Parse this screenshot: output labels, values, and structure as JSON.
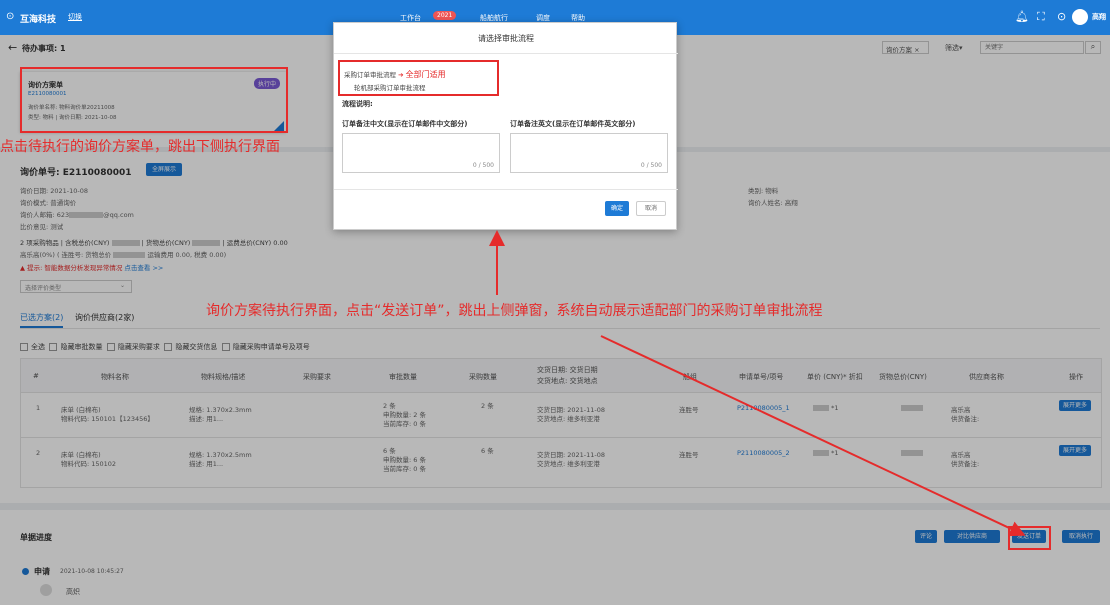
{
  "topbar": {
    "brand": "互海科技",
    "brand_tag": "切换",
    "nav": [
      "工作台",
      "船舶航行",
      "调度",
      "帮助"
    ],
    "nav_badge": "2021",
    "user": "高翔"
  },
  "page": {
    "todo_title": "待办事项: 1",
    "filter_chip": "询价方案",
    "filter_label": "筛选",
    "search_placeholder": "关键字"
  },
  "card": {
    "title": "询价方案单",
    "code": "E2110080001",
    "badge": "执行中",
    "line1": "询价单名称: 物料询价单20211008",
    "line2": "类型: 物料 | 询价日期: 2021-10-08"
  },
  "detail": {
    "order_no": "询价单号: E2110080001",
    "fullscreen_btn": "全屏展示",
    "date": "询价日期: 2021-10-08",
    "mode": "询价模式: 普通询价",
    "email": "询价人邮箱: 623",
    "email_suffix": "@qq.com",
    "remark": "比价意见: 测试",
    "category": "类别: 物料",
    "person": "询价人姓名: 高翔",
    "summary1": "2 项采购物品 | 含税总价(CNY)",
    "summary1b": "| 货物总价(CNY)",
    "summary1c": "| 运费总价(CNY) 0.00",
    "summary2": "高乐高(0%) ( 连胜号: 货物总价",
    "summary2b": "运输费用 0.00, 税费 0.00)",
    "warning": "提示: 智能数据分析发现异常情况",
    "warning_link": "点击查看 >>",
    "select_placeholder": "选择评价类型"
  },
  "tabs": [
    "已选方案(2)",
    "询价供应商(2家)"
  ],
  "checkboxes": [
    "全选",
    "隐藏审批数量",
    "隐藏采购要求",
    "隐藏交货信息",
    "隐藏采购申请单号及项号"
  ],
  "table": {
    "headers": [
      "#",
      "物料名称",
      "物料规格/描述",
      "采购要求",
      "审批数量",
      "采购数量",
      "交货日期: 交货日期\n交货地点: 交货地点",
      "船组",
      "申请单号/项号",
      "单价 (CNY)* 折扣",
      "货物总价(CNY)",
      "供应商名称",
      "操作"
    ],
    "rows": [
      {
        "idx": "1",
        "name": "床单 (白棉布)",
        "code": "物料代码: 150101【123456】",
        "spec": "规格: 1.370x2.3mm",
        "desc": "描述: 用1...",
        "qty1": "2 条",
        "qty2": "申购数量: 2 条",
        "qty3": "当前库存: 0 条",
        "buy": "2 条",
        "date": "交货日期: 2021-11-08",
        "place": "交货地点: 维多利亚港",
        "ship": "连胜号",
        "apply": "P2110080005_1",
        "price": "*1",
        "supplier": "高乐高",
        "supplier_note": "供货备注:",
        "action": "展开更多"
      },
      {
        "idx": "2",
        "name": "床单 (白棉布)",
        "code": "物料代码: 150102",
        "spec": "规格: 1.370x2.5mm",
        "desc": "描述: 用1...",
        "qty1": "6 条",
        "qty2": "申购数量: 6 条",
        "qty3": "当前库存: 0 条",
        "buy": "6 条",
        "date": "交货日期: 2021-11-08",
        "place": "交货地点: 维多利亚港",
        "ship": "连胜号",
        "apply": "P2110080005_2",
        "price": "*1",
        "supplier": "高乐高",
        "supplier_note": "供货备注:",
        "action": "展开更多"
      }
    ]
  },
  "progress": {
    "title": "单据进度",
    "buttons": [
      "评论",
      "对比供应商",
      "发送订单",
      "取消执行"
    ],
    "step": "申请",
    "step_time": "2021-10-08 10:45:27",
    "step_user": "高炽"
  },
  "modal": {
    "title": "请选择审批流程",
    "option1": "采购订单审批流程",
    "option1_note": "全部门适用",
    "option2": "轮机部采购订单审批流程",
    "desc_label": "流程说明:",
    "cn_label": "订单备注中文(显示在订单邮件中文部分)",
    "en_label": "订单备注英文(显示在订单邮件英文部分)",
    "count": "0 / 500",
    "confirm": "确定",
    "cancel": "取消"
  },
  "annotations": {
    "a1": "点击待执行的询价方案单，跳出下侧执行界面",
    "a2": "询价方案待执行界面，点击“发送订单”，跳出上侧弹窗，系统自动展示适配部门的采购订单审批流程"
  },
  "colors": {
    "primary": "#1e7bd6",
    "annotation": "#e52b2b"
  }
}
